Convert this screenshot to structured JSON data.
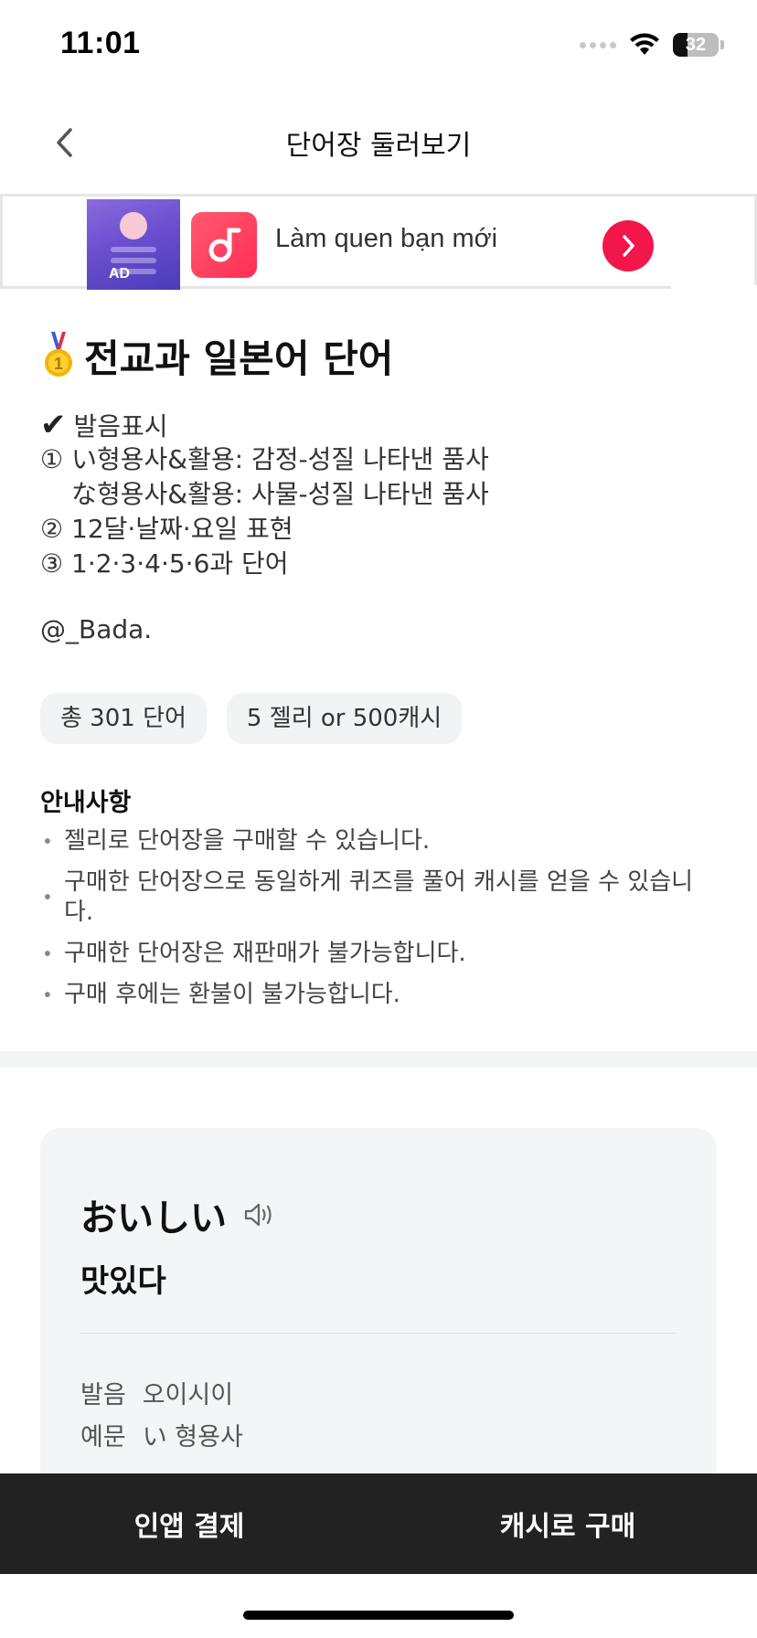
{
  "status_bar": {
    "time": "11:01",
    "battery": "32",
    "battery_level": 0.32
  },
  "nav": {
    "title": "단어장 둘러보기",
    "back_icon": "chevron-left-icon"
  },
  "ad": {
    "thumb_label": "AD",
    "text": "Làm quen bạn mới",
    "cta_icon": "chevron-right-icon",
    "cta_color": "#f2164b"
  },
  "deck": {
    "title": "전교과 일본어 단어",
    "title_icon": "medal-icon",
    "description": {
      "check_glyph": "✔",
      "line_0": "발음표시",
      "line_1": "① い형용사&활용: 감정-성질 나타낸 품사",
      "line_2": "な형용사&활용: 사물-성질 나타낸 품사",
      "line_3": "② 12달·날짜·요일 표현",
      "line_4": "③ 1·2·3·4·5·6과 단어"
    },
    "author": "@_Bada.",
    "chips": {
      "word_count": "총 301 단어",
      "price": "5 젤리 or 500캐시"
    }
  },
  "notice": {
    "title": "안내사항",
    "items": [
      "젤리로 단어장을 구매할 수 있습니다.",
      "구매한 단어장으로 동일하게 퀴즈를 풀어 캐시를 얻을 수 있습니다.",
      "구매한 단어장은 재판매가 불가능합니다.",
      "구매 후에는 환불이 불가능합니다."
    ]
  },
  "card": {
    "word": "おいしい",
    "meaning": "맛있다",
    "pronunciation_label": "발음",
    "pronunciation": "오이시이",
    "example_label": "예문",
    "example": "い 형용사"
  },
  "bottom": {
    "in_app_label": "인앱 결제",
    "cash_label": "캐시로 구매"
  }
}
